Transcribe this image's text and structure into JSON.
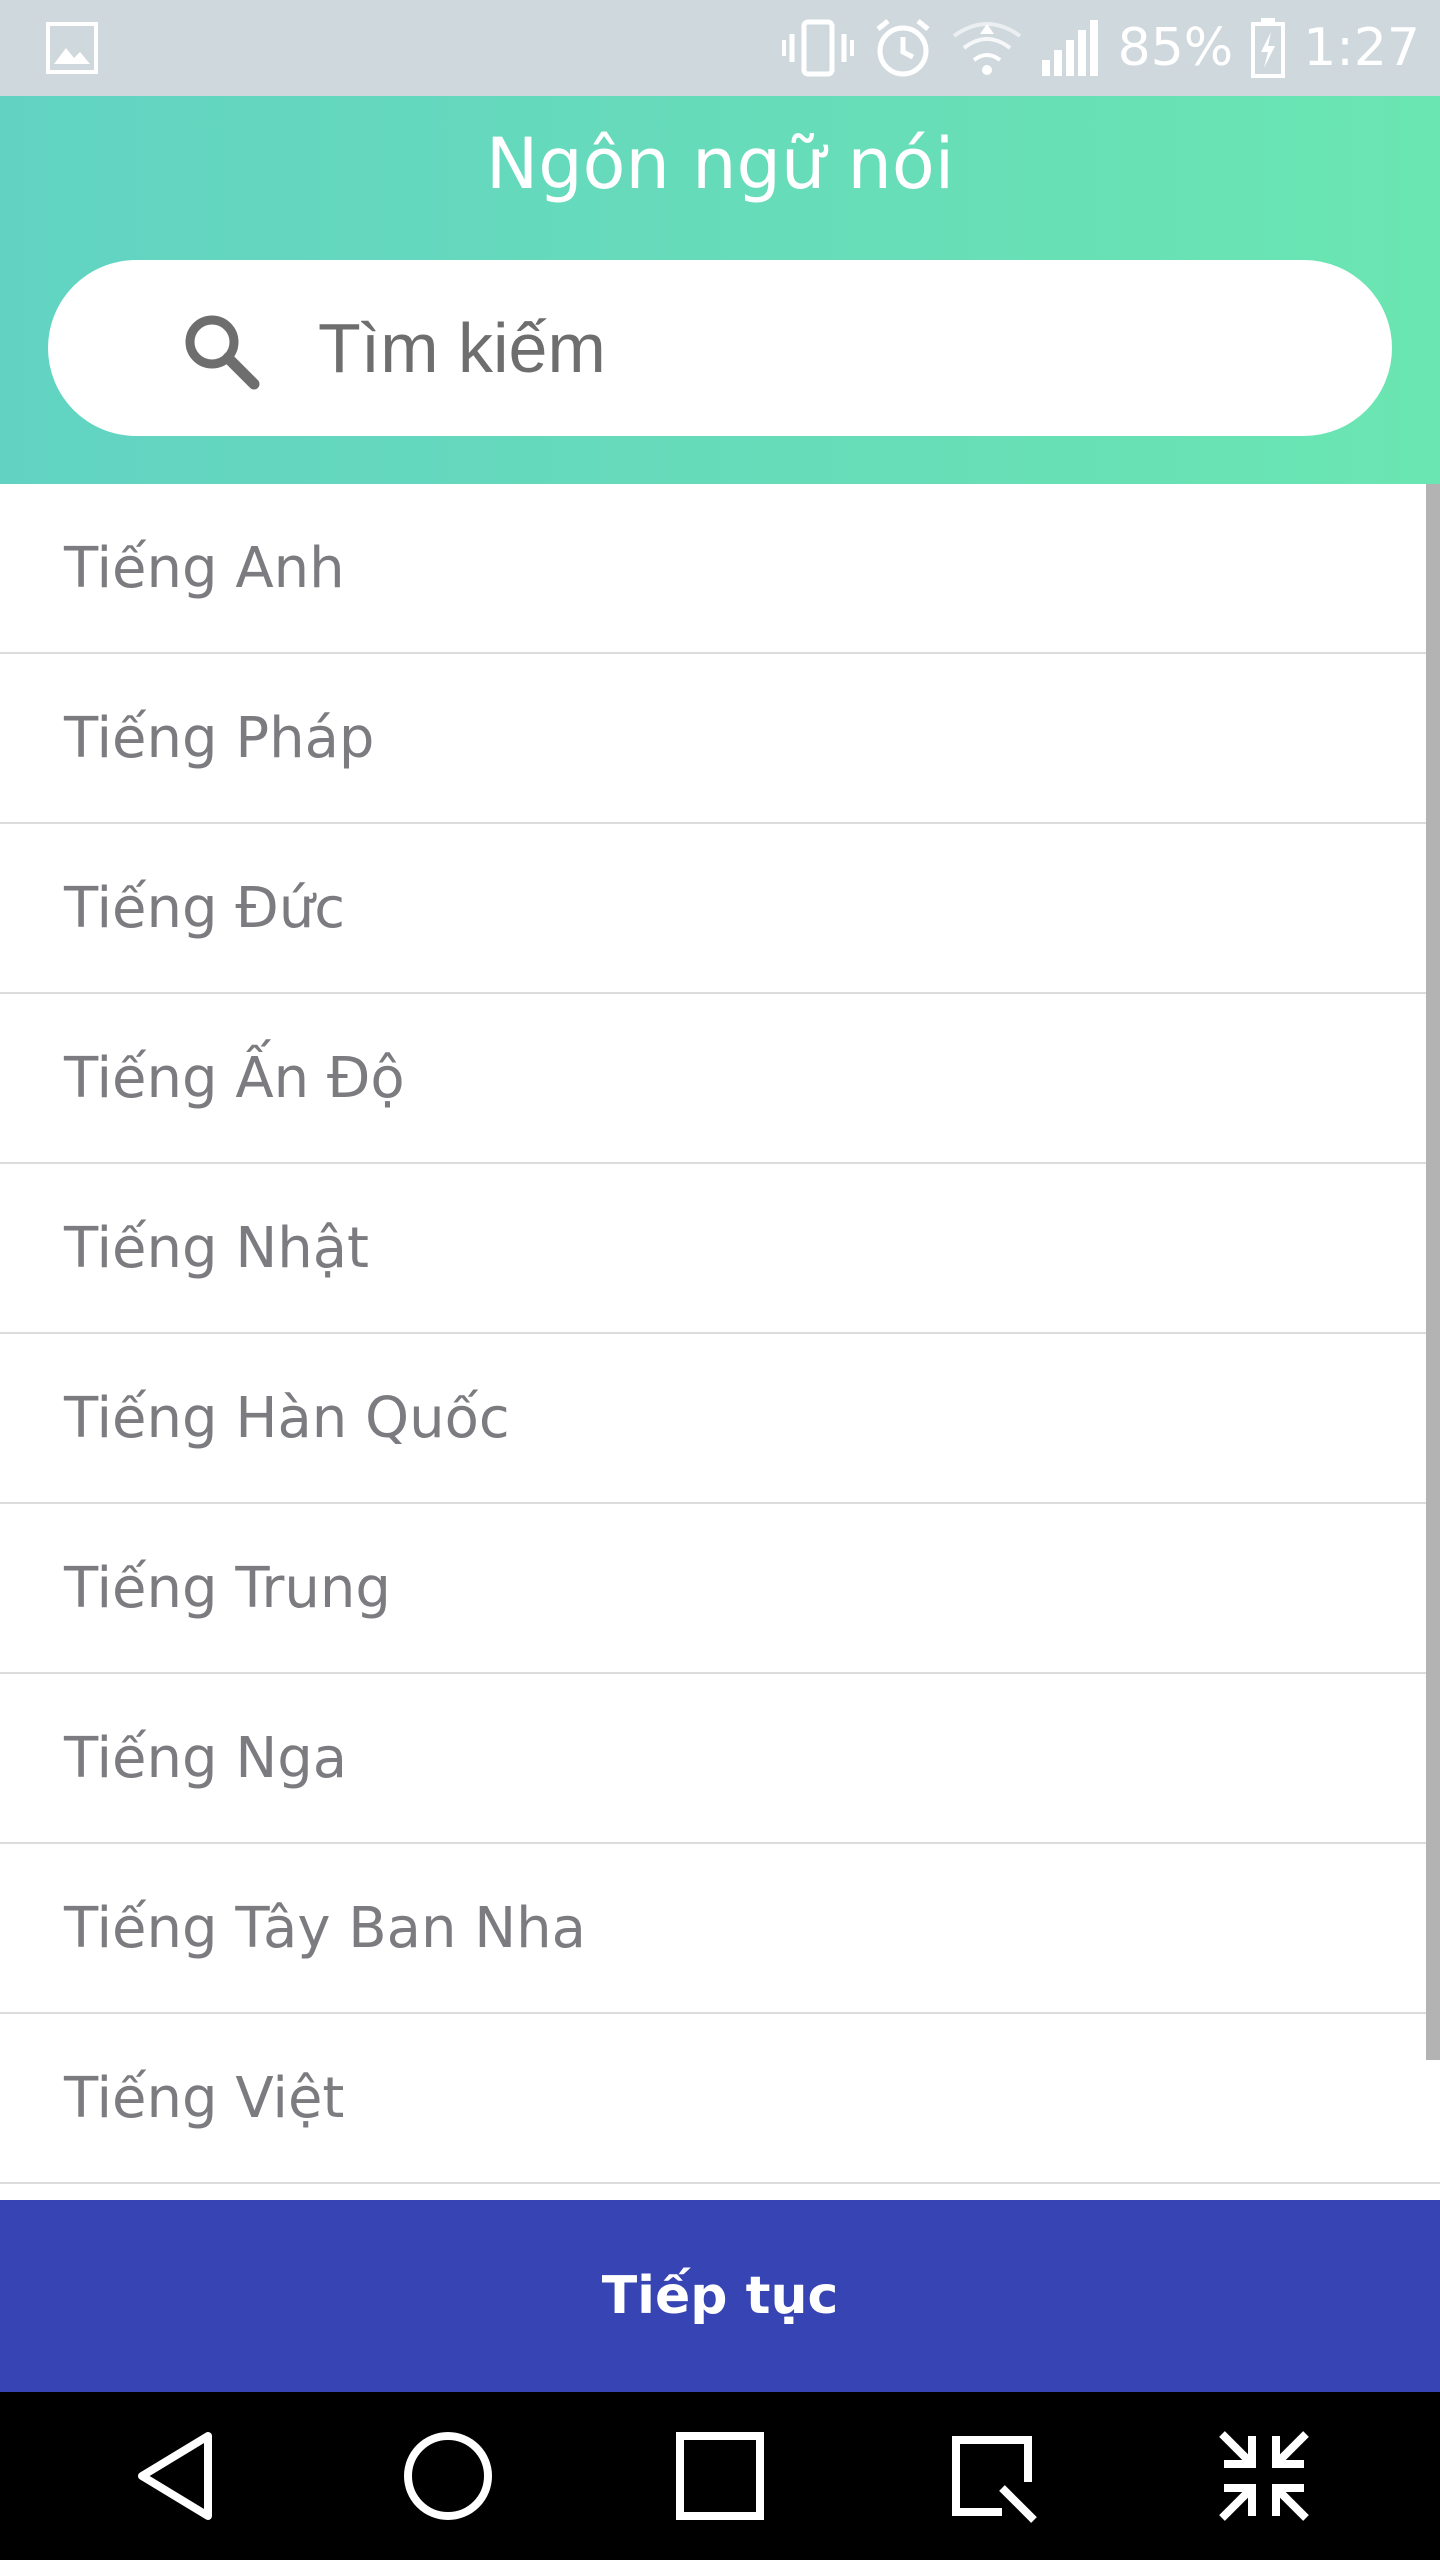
{
  "status_bar": {
    "battery": "85%",
    "time": "1:27",
    "icons": [
      "gallery-icon",
      "vibrate-icon",
      "alarm-icon",
      "wifi-icon",
      "signal-icon",
      "battery-charging-icon"
    ]
  },
  "header": {
    "title": "Ngôn ngữ nói",
    "search_placeholder": "Tìm kiếm",
    "gradient": [
      "#62d3c3",
      "#6ae6b2"
    ]
  },
  "languages": [
    "Tiếng Anh",
    "Tiếng Pháp",
    "Tiếng Đức",
    "Tiếng Ấn Độ",
    "Tiếng Nhật",
    "Tiếng Hàn Quốc",
    "Tiếng Trung",
    "Tiếng Nga",
    "Tiếng Tây Ban Nha",
    "Tiếng Việt"
  ],
  "continue_label": "Tiếp tục",
  "colors": {
    "status_bar": "#cfd8dc",
    "button": "#3744b3",
    "nav_bar": "#000000",
    "text": "#7b7b80"
  },
  "nav_bar": {
    "icons": [
      "back-icon",
      "home-icon",
      "recents-icon",
      "capture-icon",
      "minimize-icon"
    ]
  }
}
